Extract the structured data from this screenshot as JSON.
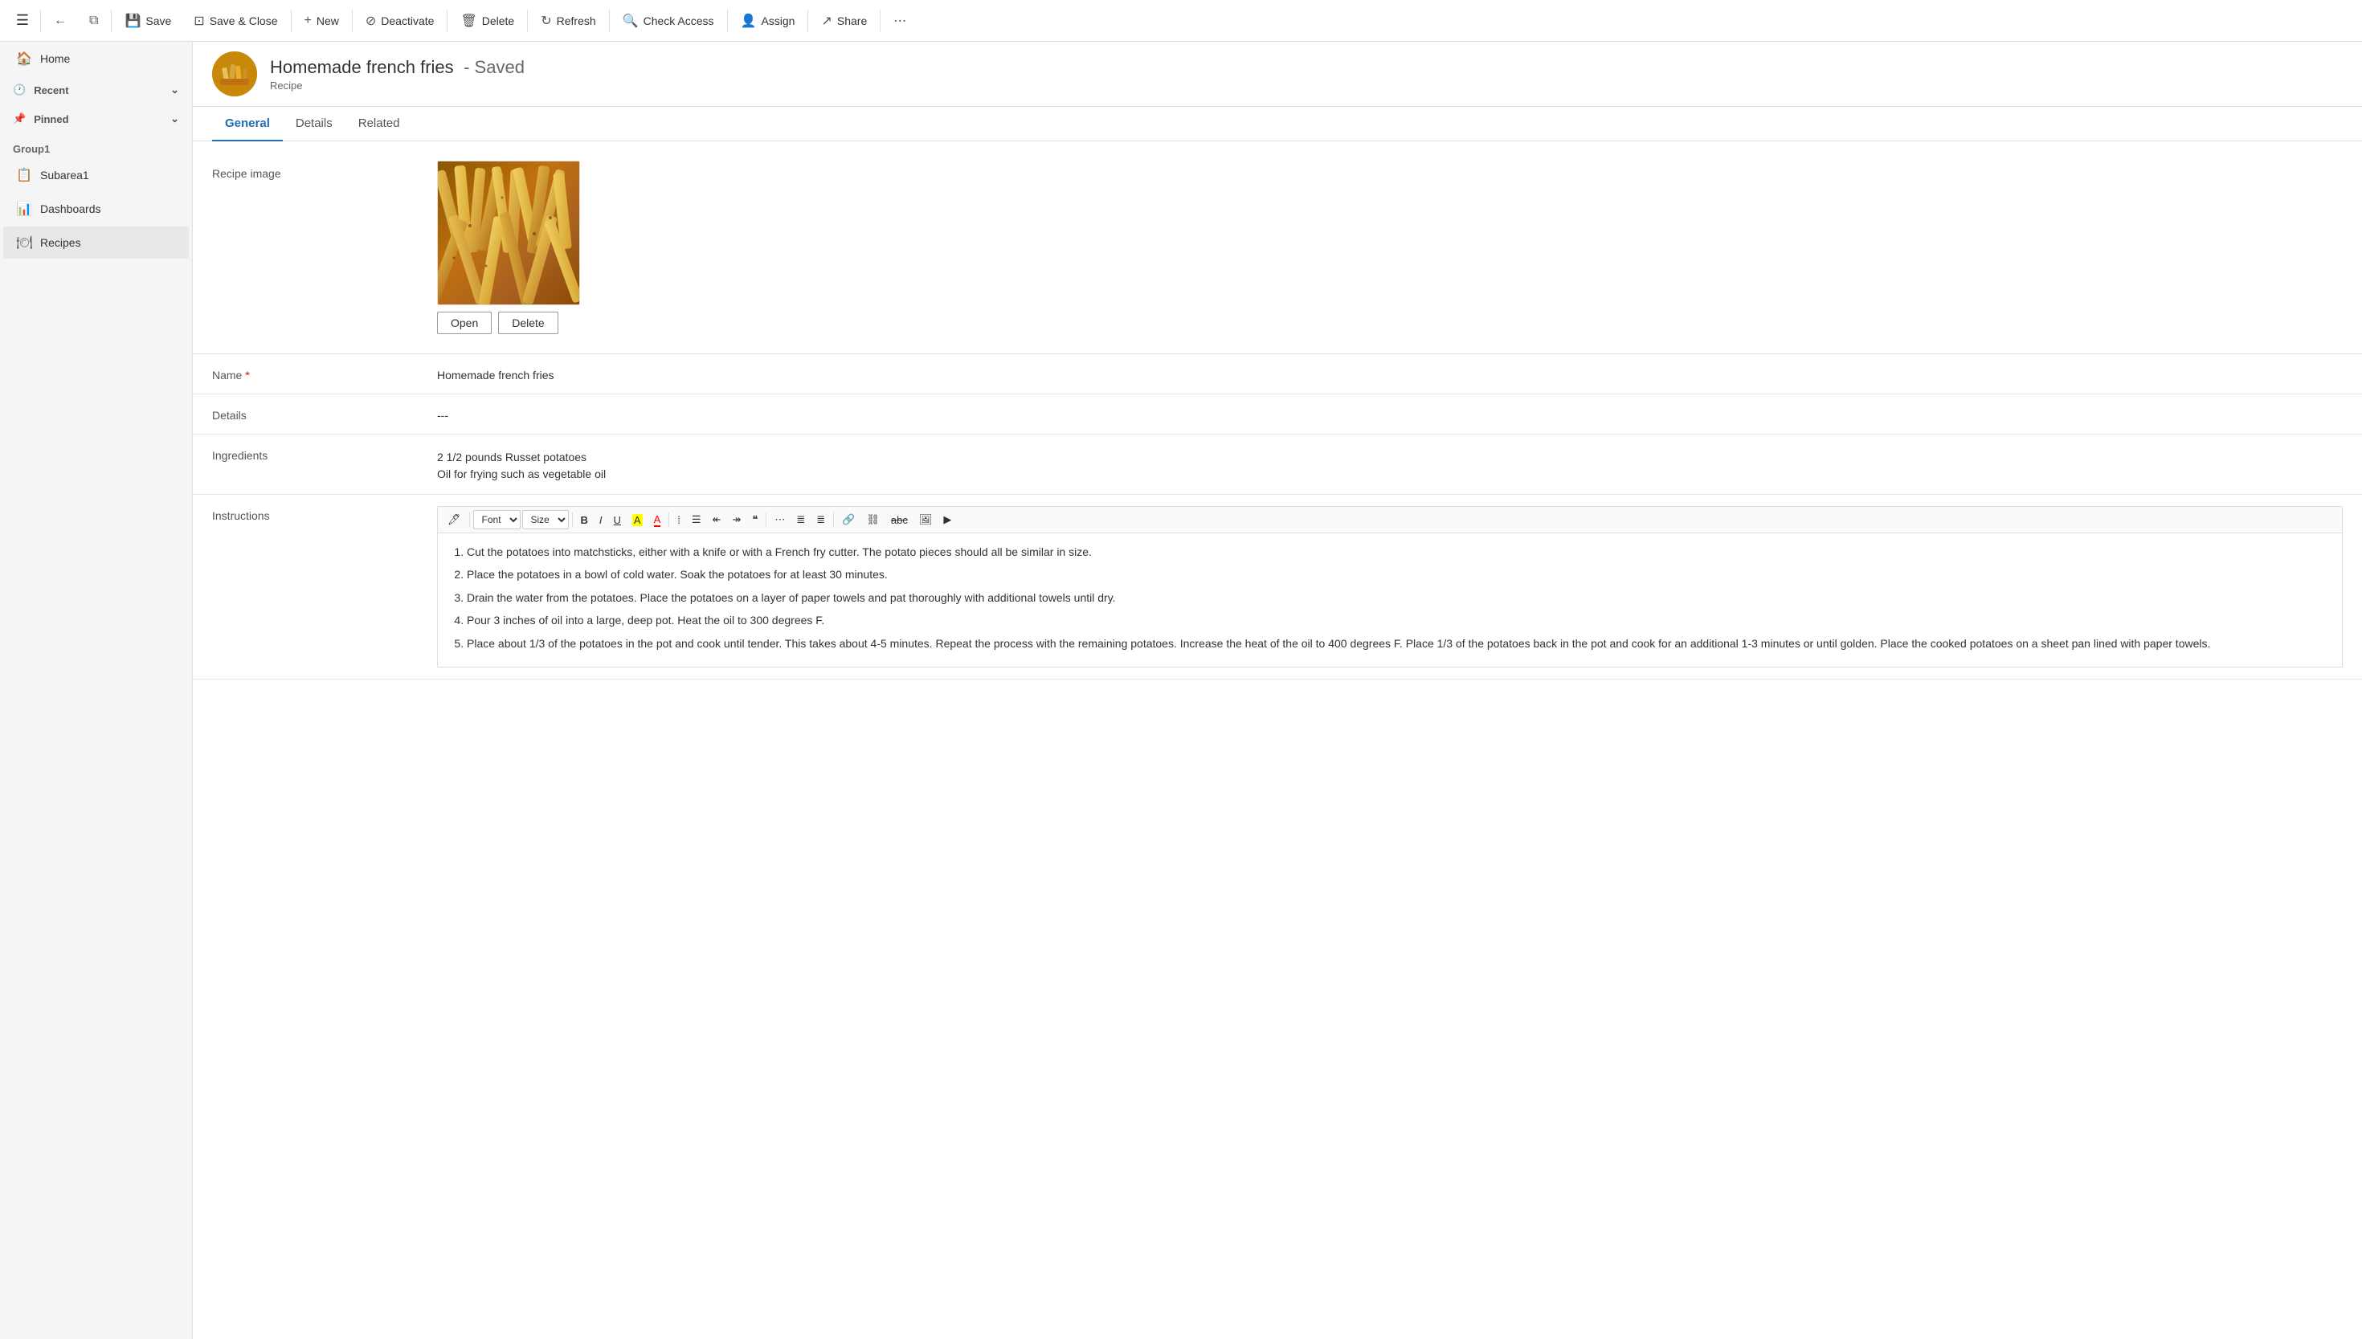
{
  "toolbar": {
    "menu_icon": "☰",
    "back_icon": "←",
    "open_window_icon": "⧉",
    "save_label": "Save",
    "save_close_label": "Save & Close",
    "new_label": "New",
    "deactivate_label": "Deactivate",
    "delete_label": "Delete",
    "refresh_label": "Refresh",
    "check_access_label": "Check Access",
    "assign_label": "Assign",
    "share_label": "Share",
    "more_icon": "..."
  },
  "sidebar": {
    "home_label": "Home",
    "recent_label": "Recent",
    "pinned_label": "Pinned",
    "group1_label": "Group1",
    "subarea1_label": "Subarea1",
    "dashboards_label": "Dashboards",
    "recipes_label": "Recipes"
  },
  "record": {
    "title": "Homemade french fries",
    "saved_status": "- Saved",
    "type_label": "Recipe"
  },
  "tabs": [
    {
      "id": "general",
      "label": "General",
      "active": true
    },
    {
      "id": "details",
      "label": "Details",
      "active": false
    },
    {
      "id": "related",
      "label": "Related",
      "active": false
    }
  ],
  "form": {
    "image_label": "Recipe image",
    "image_open_btn": "Open",
    "image_delete_btn": "Delete",
    "name_label": "Name",
    "name_required": "*",
    "name_value": "Homemade french fries",
    "details_label": "Details",
    "details_value": "---",
    "ingredients_label": "Ingredients",
    "ingredients_line1": "2 1/2 pounds Russet potatoes",
    "ingredients_line2": "Oil for frying such as vegetable oil",
    "instructions_label": "Instructions",
    "rich_toolbar": {
      "clear_format": "🖊",
      "font_label": "Font",
      "size_label": "Size",
      "bold": "B",
      "italic": "I",
      "underline": "U",
      "highlight": "A",
      "font_color": "A",
      "bullets": "≡",
      "numbering": "≡",
      "outdent": "⇐",
      "indent": "⇒",
      "blockquote": "❝",
      "align_left": "≡",
      "align_center": "≡",
      "align_right": "≡",
      "link": "🔗",
      "unlink": "⛓",
      "strikethrough": "abc",
      "image": "🖼",
      "more": "▶"
    },
    "instructions_steps": [
      "Cut the potatoes into matchsticks, either with a knife or with a French fry cutter. The potato pieces should all be similar in size.",
      "Place the potatoes in a bowl of cold water. Soak the potatoes for at least 30 minutes.",
      "Drain the water from the potatoes. Place the potatoes on a layer of paper towels and pat thoroughly with additional towels until dry.",
      "Pour 3 inches of oil into a large, deep pot. Heat the oil to 300 degrees F.",
      "Place about 1/3 of the potatoes in the pot and cook until tender. This takes about 4-5 minutes. Repeat the process with the remaining potatoes. Increase the heat of the oil to 400 degrees F. Place 1/3 of the potatoes back in the pot and cook for an additional 1-3 minutes or until golden. Place the cooked potatoes on a sheet pan lined with paper towels."
    ]
  }
}
